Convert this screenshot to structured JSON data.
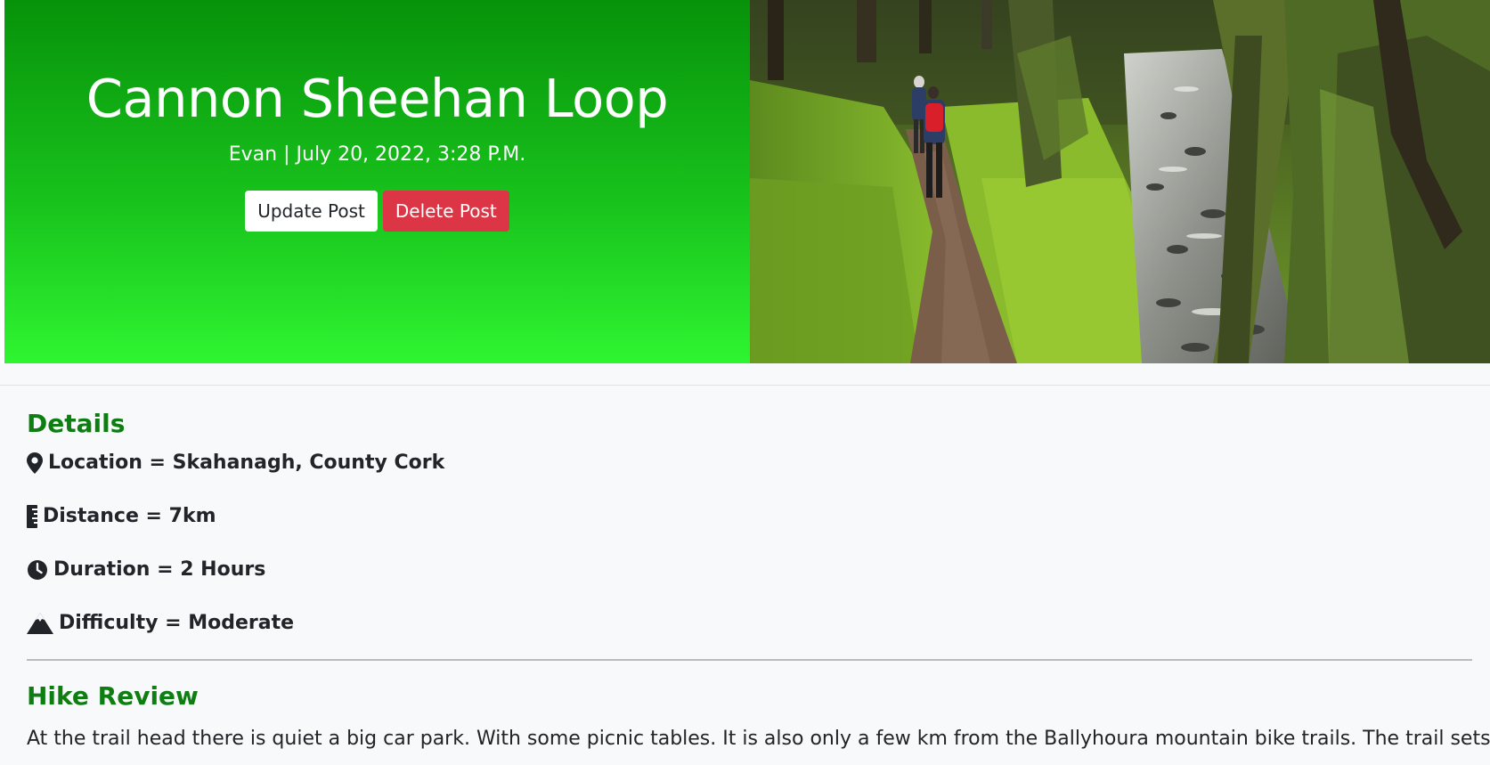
{
  "post": {
    "title": "Cannon Sheehan Loop",
    "meta": "Evan | July 20, 2022, 3:28 P.M.",
    "update_label": "Update Post",
    "delete_label": "Delete Post"
  },
  "details": {
    "heading": "Details",
    "items": [
      {
        "icon": "location-pin-icon",
        "text": "Location = Skahanagh, County Cork"
      },
      {
        "icon": "ruler-icon",
        "text": "Distance = 7km"
      },
      {
        "icon": "clock-icon",
        "text": "Duration = 2 Hours"
      },
      {
        "icon": "mountain-icon",
        "text": "Difficulty = Moderate"
      }
    ]
  },
  "review": {
    "heading": "Hike Review",
    "text": "At the trail head there is quiet a big car park. With some picnic tables. It is also only a few km from the Ballyhoura mountain bike trails. The trail sets off"
  },
  "colors": {
    "accent_green": "#0e7d12",
    "hero_gradient_top": "#07920a",
    "hero_gradient_bottom": "#2ff531",
    "danger": "#dc3545"
  }
}
